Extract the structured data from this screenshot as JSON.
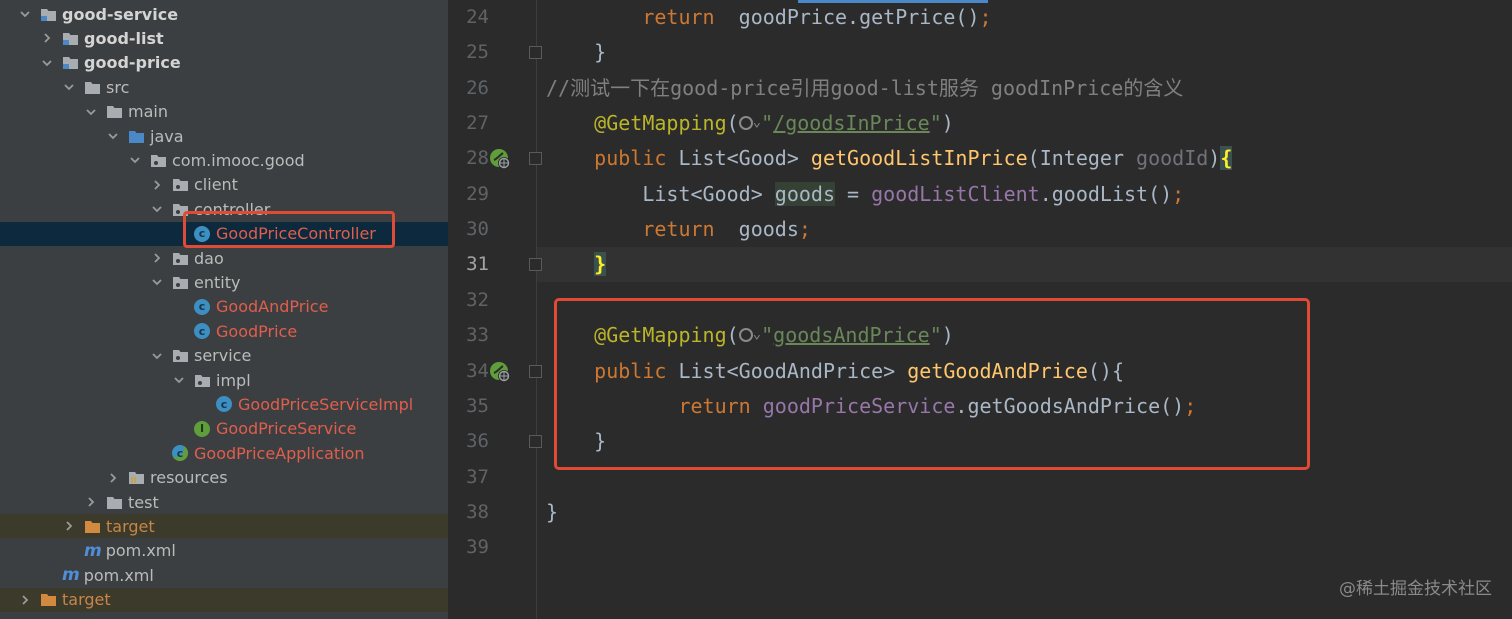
{
  "project_tree": {
    "items": [
      {
        "label": "good-service",
        "indent": 0,
        "arrow": "down",
        "icon": "module-folder-icon",
        "style": "bold"
      },
      {
        "label": "good-list",
        "indent": 1,
        "arrow": "right",
        "icon": "module-folder-icon",
        "style": "bold"
      },
      {
        "label": "good-price",
        "indent": 1,
        "arrow": "down",
        "icon": "module-folder-icon",
        "style": "bold"
      },
      {
        "label": "src",
        "indent": 2,
        "arrow": "down",
        "icon": "folder-icon",
        "style": "normal"
      },
      {
        "label": "main",
        "indent": 3,
        "arrow": "down",
        "icon": "folder-icon",
        "style": "normal"
      },
      {
        "label": "java",
        "indent": 4,
        "arrow": "down",
        "icon": "source-folder-icon",
        "style": "normal"
      },
      {
        "label": "com.imooc.good",
        "indent": 5,
        "arrow": "down",
        "icon": "package-icon",
        "style": "normal"
      },
      {
        "label": "client",
        "indent": 6,
        "arrow": "right",
        "icon": "package-icon",
        "style": "normal"
      },
      {
        "label": "controller",
        "indent": 6,
        "arrow": "down",
        "icon": "package-icon",
        "style": "normal"
      },
      {
        "label": "GoodPriceController",
        "indent": 7,
        "arrow": "none",
        "icon": "class-icon",
        "style": "red"
      },
      {
        "label": "dao",
        "indent": 6,
        "arrow": "right",
        "icon": "package-icon",
        "style": "normal"
      },
      {
        "label": "entity",
        "indent": 6,
        "arrow": "down",
        "icon": "package-icon",
        "style": "normal"
      },
      {
        "label": "GoodAndPrice",
        "indent": 7,
        "arrow": "none",
        "icon": "class-icon",
        "style": "red"
      },
      {
        "label": "GoodPrice",
        "indent": 7,
        "arrow": "none",
        "icon": "class-icon",
        "style": "red"
      },
      {
        "label": "service",
        "indent": 6,
        "arrow": "down",
        "icon": "package-icon",
        "style": "normal"
      },
      {
        "label": "impl",
        "indent": 7,
        "arrow": "down",
        "icon": "package-icon",
        "style": "normal"
      },
      {
        "label": "GoodPriceServiceImpl",
        "indent": 8,
        "arrow": "none",
        "icon": "class-icon",
        "style": "red"
      },
      {
        "label": "GoodPriceService",
        "indent": 7,
        "arrow": "none",
        "icon": "interface-icon",
        "style": "red"
      },
      {
        "label": "GoodPriceApplication",
        "indent": 6,
        "arrow": "none",
        "icon": "spring-class-icon",
        "style": "red"
      },
      {
        "label": "resources",
        "indent": 4,
        "arrow": "right",
        "icon": "resources-folder-icon",
        "style": "normal"
      },
      {
        "label": "test",
        "indent": 3,
        "arrow": "right",
        "icon": "folder-icon",
        "style": "normal"
      },
      {
        "label": "target",
        "indent": 2,
        "arrow": "right",
        "icon": "excluded-folder-icon",
        "style": "orange"
      },
      {
        "label": "pom.xml",
        "indent": 2,
        "arrow": "none",
        "icon": "maven-icon",
        "style": "normal"
      },
      {
        "label": "pom.xml",
        "indent": 1,
        "arrow": "none",
        "icon": "maven-icon",
        "style": "normal"
      },
      {
        "label": "target",
        "indent": 0,
        "arrow": "right",
        "icon": "excluded-folder-icon",
        "style": "orange"
      }
    ],
    "selected_index": 9
  },
  "editor": {
    "current_line": 31,
    "lines": [
      {
        "n": "24",
        "tokens": [
          [
            "",
            "        "
          ],
          [
            "kw",
            "return"
          ],
          [
            "",
            "  goodPrice.getPrice()"
          ],
          [
            "kw",
            ";"
          ]
        ]
      },
      {
        "n": "25",
        "tokens": [
          [
            "",
            "    }"
          ]
        ]
      },
      {
        "n": "26",
        "tokens": [
          [
            "cmt",
            "//测试一下在good-price引用good-list服务 goodInPrice的含义"
          ]
        ]
      },
      {
        "n": "27",
        "tokens": [
          [
            "",
            "    "
          ],
          [
            "ann",
            "@GetMapping"
          ],
          [
            "",
            "("
          ],
          [
            "globe",
            ""
          ],
          [
            "chev",
            "⌄"
          ],
          [
            "str-q",
            "\""
          ],
          [
            "str",
            "/goodsInPrice"
          ],
          [
            "str-q",
            "\""
          ],
          [
            "",
            ")"
          ]
        ]
      },
      {
        "n": "28",
        "tokens": [
          [
            "",
            "    "
          ],
          [
            "kw",
            "public"
          ],
          [
            "",
            " List<Good> "
          ],
          [
            "fn",
            "getGoodListInPrice"
          ],
          [
            "",
            "(Integer "
          ],
          [
            "param",
            "goodId"
          ],
          [
            "",
            ")"
          ],
          [
            "bracehl",
            "{"
          ]
        ]
      },
      {
        "n": "29",
        "tokens": [
          [
            "",
            "        List<Good> "
          ],
          [
            "hl",
            "goods"
          ],
          [
            "",
            " = "
          ],
          [
            "fld",
            "goodListClient"
          ],
          [
            "",
            ".goodList()"
          ],
          [
            "kw",
            ";"
          ]
        ]
      },
      {
        "n": "30",
        "tokens": [
          [
            "",
            "        "
          ],
          [
            "kw",
            "return"
          ],
          [
            "",
            "  goods"
          ],
          [
            "kw",
            ";"
          ]
        ]
      },
      {
        "n": "31",
        "tokens": [
          [
            "",
            "    "
          ],
          [
            "bracehl",
            "}"
          ]
        ]
      },
      {
        "n": "32",
        "tokens": []
      },
      {
        "n": "33",
        "tokens": [
          [
            "",
            "    "
          ],
          [
            "ann",
            "@GetMapping"
          ],
          [
            "",
            "("
          ],
          [
            "globe",
            ""
          ],
          [
            "chev",
            "⌄"
          ],
          [
            "str-q",
            "\""
          ],
          [
            "str",
            "goodsAndPrice"
          ],
          [
            "str-q",
            "\""
          ],
          [
            "",
            ")"
          ]
        ]
      },
      {
        "n": "34",
        "tokens": [
          [
            "",
            "    "
          ],
          [
            "kw",
            "public"
          ],
          [
            "",
            " List<GoodAndPrice> "
          ],
          [
            "fn",
            "getGoodAndPrice"
          ],
          [
            "",
            "(){"
          ]
        ]
      },
      {
        "n": "35",
        "tokens": [
          [
            "",
            "           "
          ],
          [
            "kw",
            "return"
          ],
          [
            "",
            " "
          ],
          [
            "fld",
            "goodPriceService"
          ],
          [
            "",
            ".getGoodsAndPrice()"
          ],
          [
            "kw",
            ";"
          ]
        ]
      },
      {
        "n": "36",
        "tokens": [
          [
            "",
            "    }"
          ]
        ]
      },
      {
        "n": "37",
        "tokens": []
      },
      {
        "n": "38",
        "tokens": [
          [
            "",
            "}"
          ]
        ]
      },
      {
        "n": "39",
        "tokens": []
      }
    ],
    "spring_gutter_lines": [
      "28",
      "34"
    ],
    "fold_lines": [
      "25",
      "28",
      "31",
      "34",
      "36"
    ]
  },
  "watermark": "@稀土掘金技术社区",
  "colors": {
    "highlight_box": "#e04b36",
    "accent": "#4a88c7"
  }
}
